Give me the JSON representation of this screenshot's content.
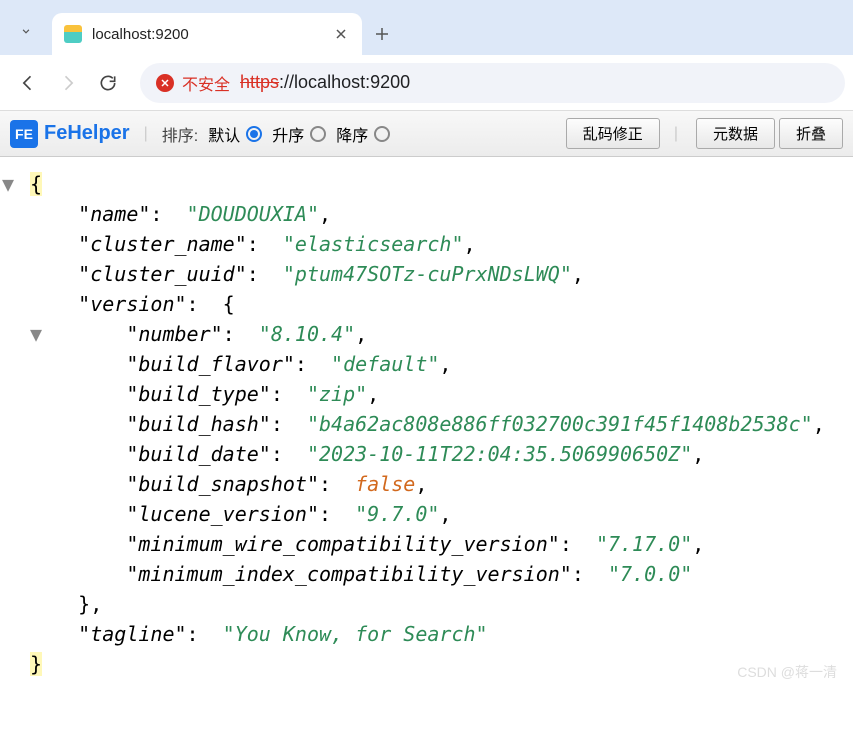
{
  "tab": {
    "title": "localhost:9200"
  },
  "omnibox": {
    "insecure_label": "不安全",
    "scheme_struck": "https",
    "rest": "://localhost:9200"
  },
  "toolbar": {
    "brand": "FeHelper",
    "sort_label": "排序:",
    "opt_default": "默认",
    "opt_asc": "升序",
    "opt_desc": "降序",
    "btn_fix": "乱码修正",
    "btn_meta": "元数据",
    "btn_fold": "折叠"
  },
  "json": {
    "name_key": "\"name\"",
    "name_val": "\"DOUDOUXIA\"",
    "cluster_name_key": "\"cluster_name\"",
    "cluster_name_val": "\"elasticsearch\"",
    "cluster_uuid_key": "\"cluster_uuid\"",
    "cluster_uuid_val": "\"ptum47SOTz-cuPrxNDsLWQ\"",
    "version_key": "\"version\"",
    "number_key": "\"number\"",
    "number_val": "\"8.10.4\"",
    "build_flavor_key": "\"build_flavor\"",
    "build_flavor_val": "\"default\"",
    "build_type_key": "\"build_type\"",
    "build_type_val": "\"zip\"",
    "build_hash_key": "\"build_hash\"",
    "build_hash_val": "\"b4a62ac808e886ff032700c391f45f1408b2538c\"",
    "build_date_key": "\"build_date\"",
    "build_date_val": "\"2023-10-11T22:04:35.506990650Z\"",
    "build_snapshot_key": "\"build_snapshot\"",
    "build_snapshot_val": "false",
    "lucene_key": "\"lucene_version\"",
    "lucene_val": "\"9.7.0\"",
    "min_wire_key": "\"minimum_wire_compatibility_version\"",
    "min_wire_val": "\"7.17.0\"",
    "min_index_key": "\"minimum_index_compatibility_version\"",
    "min_index_val": "\"7.0.0\"",
    "tagline_key": "\"tagline\"",
    "tagline_val": "\"You Know, for Search\""
  },
  "watermark": "CSDN @蒋一清"
}
